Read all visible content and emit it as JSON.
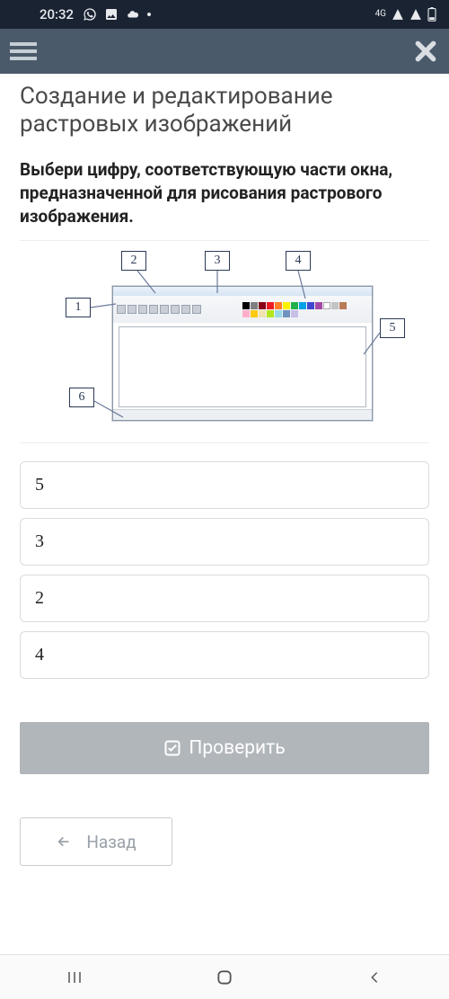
{
  "status": {
    "time": "20:32",
    "network_label": "4G"
  },
  "header": {
    "menu_icon": "hamburger",
    "close_icon": "close"
  },
  "page": {
    "title": "Создание и редактирование растровых изображений",
    "question": "Выбери цифру, соответствующую части окна, предназначенной для рисования растрового изображения."
  },
  "diagram": {
    "labels": [
      "1",
      "2",
      "3",
      "4",
      "5",
      "6"
    ]
  },
  "options": [
    {
      "value": "5"
    },
    {
      "value": "3"
    },
    {
      "value": "2"
    },
    {
      "value": "4"
    }
  ],
  "buttons": {
    "check": "Проверить",
    "back": "Назад"
  }
}
